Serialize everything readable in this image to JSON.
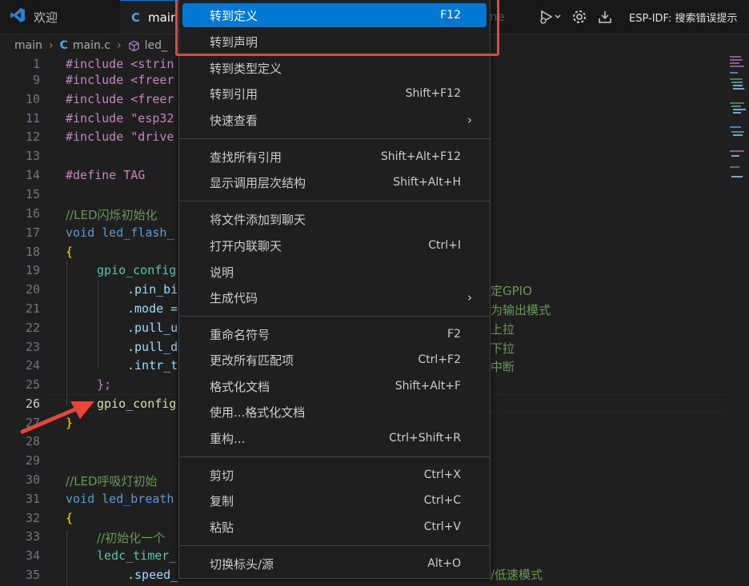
{
  "tabs": {
    "welcome_label": "欢迎",
    "main_prefix": "C",
    "main_label": "main",
    "ghost_text": "ne"
  },
  "toolbar": {
    "esp_label": "ESP-IDF: 搜索错误提示"
  },
  "breadcrumb": {
    "folder": "main",
    "file_prefix": "C",
    "file": "main.c",
    "symbol": "led_"
  },
  "editor": {
    "lines": [
      {
        "no": "1",
        "text": "#include <strin"
      },
      {
        "no": "9",
        "text": "#include <freer"
      },
      {
        "no": "10",
        "text": "#include <freer"
      },
      {
        "no": "11",
        "text": "#include \"esp32"
      },
      {
        "no": "12",
        "text": "#include \"drive"
      },
      {
        "no": "13",
        "text": ""
      },
      {
        "no": "14",
        "text": "#define TAG"
      },
      {
        "no": "15",
        "text": ""
      },
      {
        "no": "16",
        "text": "//LED闪烁初始化"
      },
      {
        "no": "17",
        "text": "void led_flash_"
      },
      {
        "no": "18",
        "text": "{"
      },
      {
        "no": "19",
        "text": "gpio_config"
      },
      {
        "no": "20",
        "text": ".pin_bi"
      },
      {
        "no": "21",
        "text": ".mode ="
      },
      {
        "no": "22",
        "text": ".pull_u"
      },
      {
        "no": "23",
        "text": ".pull_d"
      },
      {
        "no": "24",
        "text": ".intr_t"
      },
      {
        "no": "25",
        "text": "};"
      },
      {
        "no": "26",
        "text": "gpio_config"
      },
      {
        "no": "27",
        "text": "}"
      },
      {
        "no": "28",
        "text": ""
      },
      {
        "no": "29",
        "text": ""
      },
      {
        "no": "30",
        "text": "//LED呼吸灯初始"
      },
      {
        "no": "31",
        "text": "void led_breath"
      },
      {
        "no": "32",
        "text": "{"
      },
      {
        "no": "33",
        "text": "//初始化一个"
      },
      {
        "no": "34",
        "text": "ledc_timer_"
      },
      {
        "no": "35",
        "text": ".speed_"
      }
    ],
    "right_comments": [
      "定GPIO",
      "为输出模式",
      "上拉",
      "下拉",
      "中断",
      "/低速模式"
    ]
  },
  "context_menu": {
    "items": [
      {
        "label": "转到定义",
        "shortcut": "F12"
      },
      {
        "label": "转到声明",
        "shortcut": ""
      },
      {
        "label": "转到类型定义",
        "shortcut": ""
      },
      {
        "label": "转到引用",
        "shortcut": "Shift+F12"
      },
      {
        "label": "快速查看",
        "shortcut": ""
      },
      {
        "label": "查找所有引用",
        "shortcut": "Shift+Alt+F12"
      },
      {
        "label": "显示调用层次结构",
        "shortcut": "Shift+Alt+H"
      },
      {
        "label": "将文件添加到聊天",
        "shortcut": ""
      },
      {
        "label": "打开内联聊天",
        "shortcut": "Ctrl+I"
      },
      {
        "label": "说明",
        "shortcut": ""
      },
      {
        "label": "生成代码",
        "shortcut": ""
      },
      {
        "label": "重命名符号",
        "shortcut": "F2"
      },
      {
        "label": "更改所有匹配项",
        "shortcut": "Ctrl+F2"
      },
      {
        "label": "格式化文档",
        "shortcut": "Shift+Alt+F"
      },
      {
        "label": "使用...格式化文档",
        "shortcut": ""
      },
      {
        "label": "重构...",
        "shortcut": "Ctrl+Shift+R"
      },
      {
        "label": "剪切",
        "shortcut": "Ctrl+X"
      },
      {
        "label": "复制",
        "shortcut": "Ctrl+C"
      },
      {
        "label": "粘贴",
        "shortcut": "Ctrl+V"
      },
      {
        "label": "切换标头/源",
        "shortcut": "Alt+O"
      }
    ],
    "submenu_arrow": "›"
  },
  "colors": {
    "accent": "#0078d4",
    "annotation": "#e8453c"
  }
}
